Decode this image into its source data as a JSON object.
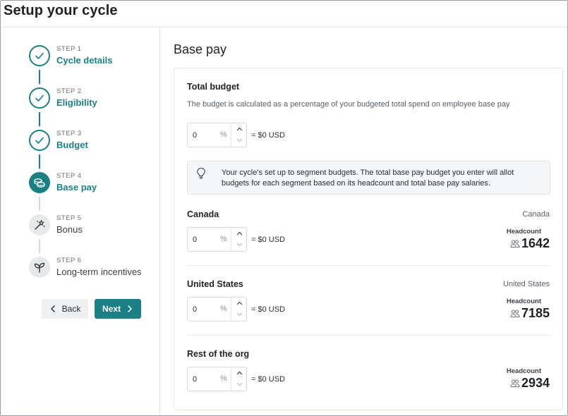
{
  "window": {
    "title": "Setup your cycle"
  },
  "steps": [
    {
      "kicker": "STEP 1",
      "label": "Cycle details",
      "state": "done",
      "icon": "check-icon"
    },
    {
      "kicker": "STEP 2",
      "label": "Eligibility",
      "state": "done",
      "icon": "check-icon"
    },
    {
      "kicker": "STEP 3",
      "label": "Budget",
      "state": "done",
      "icon": "check-icon"
    },
    {
      "kicker": "STEP 4",
      "label": "Base pay",
      "state": "current",
      "icon": "coins-icon"
    },
    {
      "kicker": "STEP 5",
      "label": "Bonus",
      "state": "todo",
      "icon": "sparkle-wand-icon"
    },
    {
      "kicker": "STEP 6",
      "label": "Long-term incentives",
      "state": "todo",
      "icon": "sprout-icon"
    }
  ],
  "nav": {
    "back_label": "Back",
    "next_label": "Next"
  },
  "main": {
    "title": "Base pay",
    "total_budget": {
      "title": "Total budget",
      "description": "The budget is calculated as a percentage of your budgeted total spend on employee base pay",
      "value": "0",
      "unit": "%",
      "result": "= $0 USD"
    },
    "info": {
      "icon": "lightbulb-icon",
      "text": "Your cycle's set up to segment budgets. The total base pay budget you enter will allot budgets for each segment based on its headcount and total base pay salaries."
    },
    "segments": [
      {
        "name": "Canada",
        "region": "Canada",
        "value": "0",
        "unit": "%",
        "result": "= $0 USD",
        "headcount_label": "Headcount",
        "headcount": "1642"
      },
      {
        "name": "United States",
        "region": "United States",
        "value": "0",
        "unit": "%",
        "result": "= $0 USD",
        "headcount_label": "Headcount",
        "headcount": "7185"
      },
      {
        "name": "Rest of the org",
        "region": "",
        "value": "0",
        "unit": "%",
        "result": "= $0 USD",
        "headcount_label": "Headcount",
        "headcount": "2934"
      }
    ]
  },
  "colors": {
    "accent": "#1b7f84",
    "muted": "#e6e8ea"
  }
}
